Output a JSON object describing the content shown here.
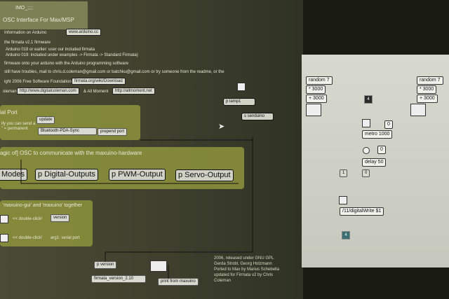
{
  "left_patch": {
    "title_partial": "IMO_;;;;",
    "subtitle": "OSC Interface For Max/MSP",
    "info_line": "Information on Arduino",
    "arduino_link": "www.arduino.cc",
    "firmata_line": "the firmata v2.1 firmware",
    "arduino018": "Arduino 018 or earlier: user our included firmata",
    "arduino019": "Arduino 019: included under examples -> Firmata -> Standard Firmata)",
    "upload_line": "firmware onto your arduino with the Arduino programming software",
    "trouble_line": "still have troubles, mail to chris.d.coleman@gmail.com or batchku@gmail.com or try someone from the readme, or the",
    "copyright": "ight 2006 Free Software Foundation",
    "firmata_link": "firmata.org/wiki/Download",
    "coleman": "oleman",
    "coleman_link": "http://www.digitalcoleman.com",
    "and_all": "& All Moment",
    "allmoment_link": "http://allmoment.net",
    "serial_header": "ial Port",
    "serial_text1": "ify you can send a",
    "serial_text2": "\" = permanent",
    "update_btn": "update",
    "port_select": "Bluetooth-PDA-Sync",
    "prepend_port": "prepend port",
    "magic_header": "agic of] OSC to communicate with the maxuino-hardware",
    "modes": "Modes",
    "digital_outputs": "p Digital-Outputs",
    "pwm_output": "p PWM-Output",
    "servo_output": "p Servo-Output",
    "together_header": "'maxuino-gui' and 'maxuino' together",
    "dbl1": "<< double-click!",
    "version_btn": "version",
    "dbl2": "<< double-click!",
    "arg1": "arg1: serial port",
    "p_version": "p version",
    "firmata_version": "firmata_version_2.10",
    "print_from": "print from maxuino",
    "lamp": "p lamp1",
    "senduino": "s senduino",
    "credits": [
      "2006, released under GNU GPL",
      "Gerda Strobl, Georg Holzmann",
      "Ported to Max by Marius Schebella",
      "updated for Firmata v2 by Chris",
      "Coleman"
    ]
  },
  "right_patch": {
    "random1": "random 7",
    "random2": "random 7",
    "mul1": "* 3000",
    "mul2": "* 3000",
    "add1": "+ 3000",
    "add2": "+ 3000",
    "num_4a": "4",
    "val0": "0",
    "metro": "metro 1000",
    "val0b": "0",
    "delay": "delay 50",
    "msg1": "1",
    "msg0": "0",
    "digital_write": "/11/digitalWrite $1",
    "num_4b": "4"
  }
}
